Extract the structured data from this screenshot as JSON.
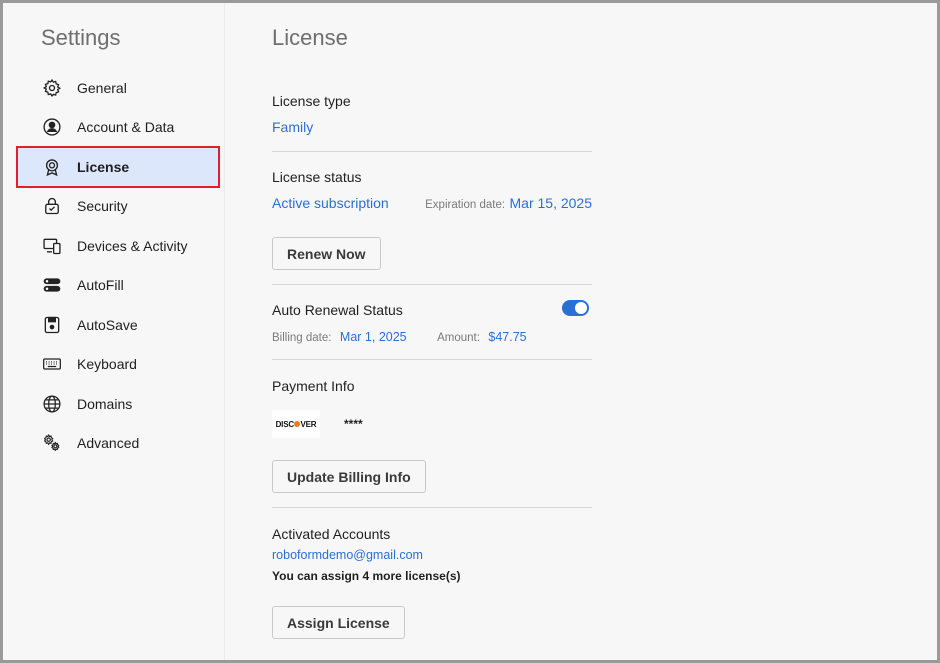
{
  "sidebar": {
    "title": "Settings",
    "items": [
      {
        "label": "General",
        "icon": "gear-icon"
      },
      {
        "label": "Account & Data",
        "icon": "user-circle-icon"
      },
      {
        "label": "License",
        "icon": "award-badge-icon",
        "active": true
      },
      {
        "label": "Security",
        "icon": "lock-icon"
      },
      {
        "label": "Devices & Activity",
        "icon": "devices-icon"
      },
      {
        "label": "AutoFill",
        "icon": "autofill-icon"
      },
      {
        "label": "AutoSave",
        "icon": "save-icon"
      },
      {
        "label": "Keyboard",
        "icon": "keyboard-icon"
      },
      {
        "label": "Domains",
        "icon": "globe-icon"
      },
      {
        "label": "Advanced",
        "icon": "gears-icon"
      }
    ]
  },
  "main": {
    "title": "License",
    "license_type": {
      "label": "License type",
      "value": "Family"
    },
    "license_status": {
      "label": "License status",
      "value": "Active subscription",
      "expiration_label": "Expiration date:",
      "expiration_value": "Mar 15, 2025"
    },
    "renew_button": "Renew Now",
    "auto_renewal": {
      "label": "Auto Renewal Status",
      "enabled": true,
      "billing_label": "Billing date:",
      "billing_value": "Mar 1, 2025",
      "amount_label": "Amount:",
      "amount_value": "$47.75"
    },
    "payment": {
      "label": "Payment Info",
      "card_brand": "DISCOVER",
      "card_number": "****"
    },
    "update_billing_button": "Update Billing Info",
    "activated_accounts": {
      "label": "Activated Accounts",
      "email": "roboformdemo@gmail.com",
      "note": "You can assign 4 more license(s)"
    },
    "assign_button": "Assign License"
  },
  "colors": {
    "accent": "#2a6fd6",
    "active_bg": "#dde7fb",
    "highlight_border": "#e0202d"
  }
}
